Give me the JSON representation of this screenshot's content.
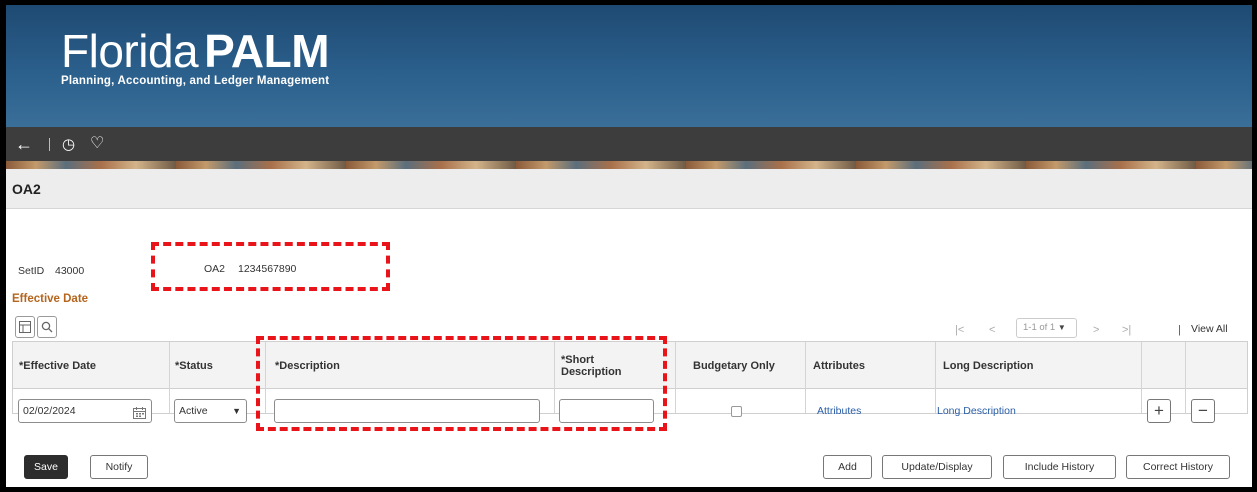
{
  "logo": {
    "brand_first": "Florida",
    "brand_second": "PALM",
    "subtitle": "Planning, Accounting, and Ledger Management"
  },
  "nav": {
    "back_icon": "←",
    "history_icon": "◷",
    "favorite_icon": "♡"
  },
  "page_title": "OA2",
  "fields": {
    "setid_label": "SetID",
    "setid_value": "43000",
    "oa2_label": "OA2",
    "oa2_value": "1234567890"
  },
  "section_title": "Effective Date",
  "pager": {
    "first": "|<",
    "prev": "<",
    "range": "1-1 of 1",
    "next": ">",
    "last": ">|",
    "sep": "|",
    "view_all": "View All"
  },
  "grid": {
    "headers": {
      "effective_date": "*Effective Date",
      "status": "*Status",
      "description": "*Description",
      "short_description_1": "*Short",
      "short_description_2": "Description",
      "budgetary_only": "Budgetary Only",
      "attributes": "Attributes",
      "long_description": "Long Description"
    },
    "row": {
      "effective_date": "02/02/2024",
      "status": "Active",
      "description": "",
      "short_description": "",
      "budgetary_only": false,
      "attributes_link": "Attributes",
      "long_description_link": "Long Description",
      "add_row": "+",
      "delete_row": "−"
    }
  },
  "buttons": {
    "save": "Save",
    "notify": "Notify",
    "add": "Add",
    "update_display": "Update/Display",
    "include_history": "Include History",
    "correct_history": "Correct History"
  },
  "colors": {
    "banner": "#2b5f8c",
    "navbar": "#3d3d3d",
    "section_title": "#b5651d",
    "link": "#2a5ea8",
    "highlight": "#e8141a"
  }
}
